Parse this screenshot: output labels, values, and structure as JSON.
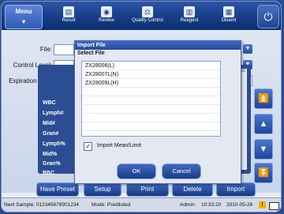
{
  "toolbar": {
    "menu": "Menu",
    "result": "Result",
    "review": "Review",
    "quality_control": "Quality Control",
    "reagent": "Reagent",
    "diluent": "Diluent"
  },
  "form": {
    "file_label": "File:",
    "control_level_label": "Control Level:",
    "expiration_date_label": "Expiration Date:"
  },
  "panel": {
    "right_header": "ess",
    "params": [
      "WBC",
      "Lymph#",
      "Mid#",
      "Gran#",
      "Lymph%",
      "Mid%",
      "Gran%",
      "RBC"
    ]
  },
  "bottom": {
    "have_preset": "Have Preset",
    "setup": "Setup",
    "print": "Print",
    "delete": "Delete",
    "import": "Import"
  },
  "status": {
    "next_sample": "Next Sample: 012345678901234",
    "mode": "Mode: Prediluted",
    "user": "Admin:",
    "time": "10:33:20",
    "date": "2010-05-26"
  },
  "dialog": {
    "title": "Import File",
    "subtitle": "Select File",
    "files": [
      "ZX28006(L)",
      "ZX28007L(N)",
      "ZX28009L(H)"
    ],
    "import_mean_label": "Import Mean/Limit",
    "import_mean_checked": true,
    "ok": "OK",
    "cancel": "Cancel"
  }
}
